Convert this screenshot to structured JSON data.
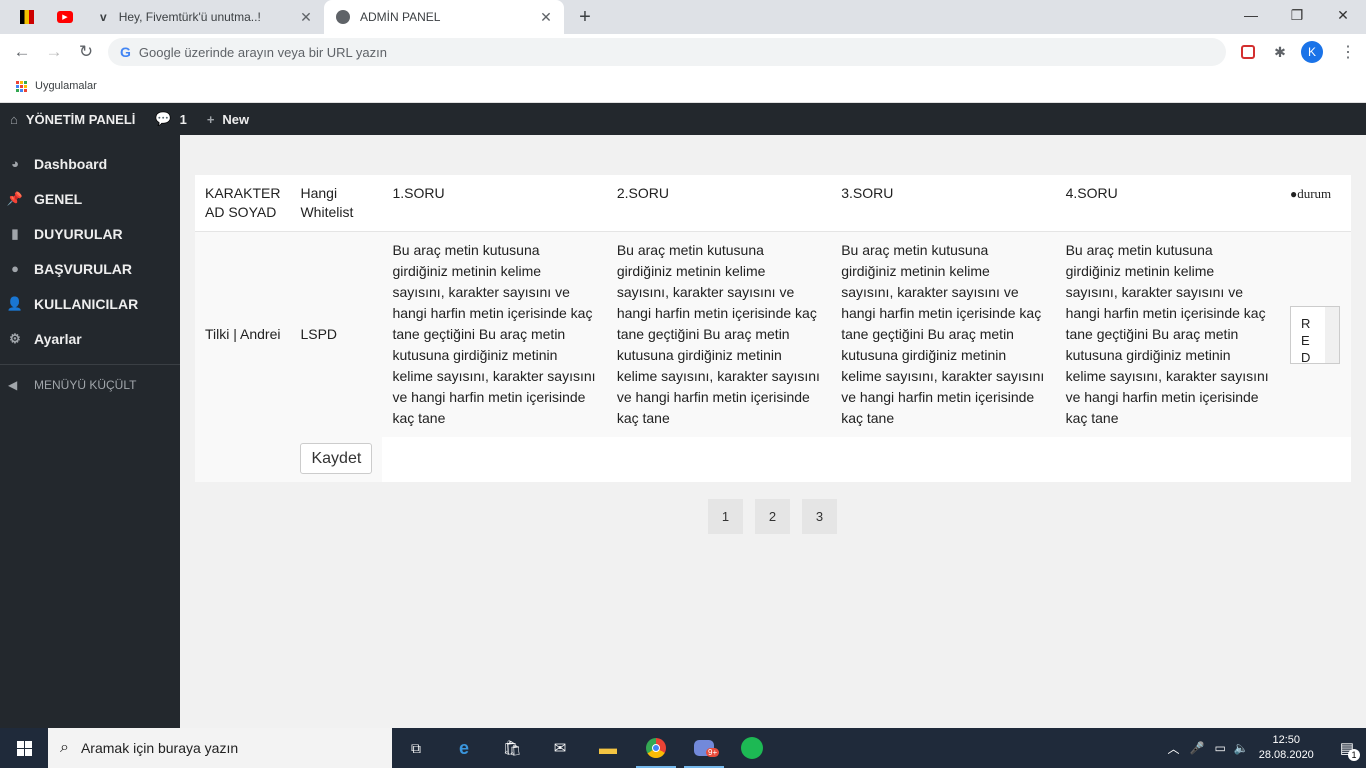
{
  "browser": {
    "tabs": [
      {
        "label": "Hey, Fivemtürk'ü unutma..!",
        "active": false
      },
      {
        "label": "ADMİN PANEL",
        "active": true
      }
    ],
    "omnibox_placeholder": "Google üzerinde arayın veya bir URL yazın",
    "profile_initial": "K",
    "bookmarks_apps_label": "Uygulamalar"
  },
  "adminbar": {
    "site_label": "YÖNETİM PANELİ",
    "comments_count": "1",
    "new_label": "New"
  },
  "sidebar": {
    "items": [
      {
        "label": "Dashboard",
        "icon": "dashboard-icon"
      },
      {
        "label": "GENEL",
        "icon": "pin-icon"
      },
      {
        "label": "DUYURULAR",
        "icon": "page-icon"
      },
      {
        "label": "BAŞVURULAR",
        "icon": "comment-icon"
      },
      {
        "label": "KULLANICILAR",
        "icon": "user-icon"
      },
      {
        "label": "Ayarlar",
        "icon": "gear-icon"
      }
    ],
    "collapse_label": "MENÜYÜ KÜÇÜLT"
  },
  "table": {
    "headers": [
      "KARAKTER AD SOYAD",
      "Hangi Whitelist",
      "1.SORU",
      "2.SORU",
      "3.SORU",
      "4.SORU",
      "durum"
    ],
    "rows": [
      {
        "name": "Tilki | Andrei",
        "whitelist": "LSPD",
        "answers": [
          "Bu araç metin kutusuna girdiğiniz metinin kelime sayısını, karakter sayısını ve hangi harfin metin içerisinde kaç tane geçtiğini Bu araç metin kutusuna girdiğiniz metinin kelime sayısını, karakter sayısını ve hangi harfin metin içerisinde kaç tane",
          "Bu araç metin kutusuna girdiğiniz metinin kelime sayısını, karakter sayısını ve hangi harfin metin içerisinde kaç tane geçtiğini Bu araç metin kutusuna girdiğiniz metinin kelime sayısını, karakter sayısını ve hangi harfin metin içerisinde kaç tane",
          "Bu araç metin kutusuna girdiğiniz metinin kelime sayısını, karakter sayısını ve hangi harfin metin içerisinde kaç tane geçtiğini Bu araç metin kutusuna girdiğiniz metinin kelime sayısını, karakter sayısını ve hangi harfin metin içerisinde kaç tane",
          "Bu araç metin kutusuna girdiğiniz metinin kelime sayısını, karakter sayısını ve hangi harfin metin içerisinde kaç tane geçtiğini Bu araç metin kutusuna girdiğiniz metinin kelime sayısını, karakter sayısını ve hangi harfin metin içerisinde kaç tane"
        ],
        "status": "RED"
      }
    ],
    "save_label": "Kaydet"
  },
  "pagination": [
    "1",
    "2",
    "3"
  ],
  "taskbar": {
    "search_placeholder": "Aramak için buraya yazın",
    "time": "12:50",
    "date": "28.08.2020",
    "notification_count": "1",
    "discord_badge": "9+"
  }
}
